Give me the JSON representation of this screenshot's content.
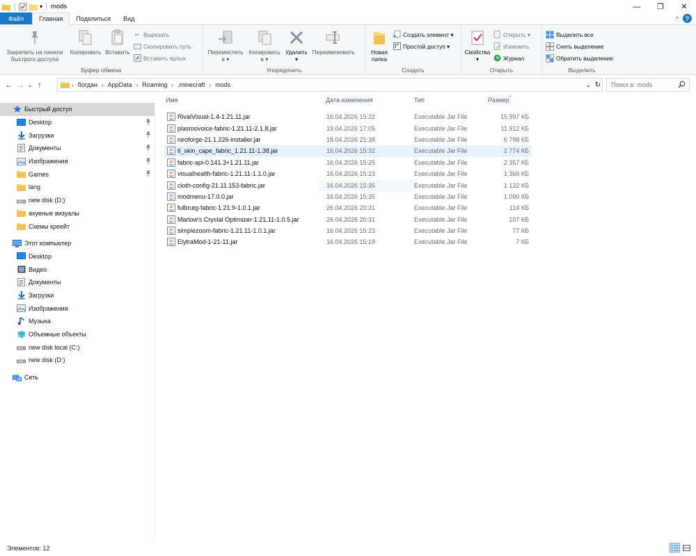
{
  "window": {
    "title": "mods",
    "controls": [
      "—",
      "❐",
      "✕"
    ]
  },
  "ribbon_tabs": [
    {
      "label": "Файл",
      "kind": "file"
    },
    {
      "label": "Главная",
      "kind": "active"
    },
    {
      "label": "Поделиться",
      "kind": "normal"
    },
    {
      "label": "Вид",
      "kind": "normal"
    }
  ],
  "ribbon": {
    "clipboard": {
      "label": "Буфер обмена",
      "pin": "Закрепить на панели быстрого доступа",
      "pin_l1": "Закрепить на панели",
      "pin_l2": "быстрого доступа",
      "copy": "Копировать",
      "paste": "Вставить",
      "cut": "Вырезать",
      "copy_path": "Скопировать путь",
      "paste_shortcut": "Вставить ярлык"
    },
    "organize": {
      "label": "Упорядочить",
      "move_l1": "Переместить",
      "move_l2": "в ▾",
      "copy_l1": "Копировать",
      "copy_l2": "в ▾",
      "delete_l1": "Удалить",
      "delete_l2": "▾",
      "rename": "Переименовать"
    },
    "create": {
      "label": "Создать",
      "new_folder_l1": "Новая",
      "new_folder_l2": "папка",
      "new_item": "Создать элемент ▾",
      "easy_access": "Простой доступ ▾"
    },
    "open": {
      "label": "Открыть",
      "properties_l1": "Свойства",
      "properties_l2": "▾",
      "open": "Открыть ▾",
      "edit": "Изменить",
      "history": "Журнал"
    },
    "select": {
      "label": "Выделить",
      "select_all": "Выделить все",
      "select_none": "Снять выделение",
      "invert": "Обратить выделение"
    }
  },
  "address": {
    "crumbs": [
      "богдан",
      "AppData",
      "Roaming",
      ".minecraft",
      "mods"
    ],
    "search_placeholder": "Поиск в: mods"
  },
  "nav": {
    "quick_access": "Быстрый доступ",
    "quick_items": [
      {
        "label": "Desktop",
        "icon": "desktop-icon",
        "pinned": true
      },
      {
        "label": "Загрузки",
        "icon": "downloads-icon",
        "pinned": true
      },
      {
        "label": "Документы",
        "icon": "documents-icon",
        "pinned": true
      },
      {
        "label": "Изображения",
        "icon": "pictures-icon",
        "pinned": true
      },
      {
        "label": "Games",
        "icon": "folder-icon",
        "pinned": true
      },
      {
        "label": "lang",
        "icon": "folder-icon",
        "pinned": false
      },
      {
        "label": "new disk (D:)",
        "icon": "drive-icon",
        "pinned": false
      },
      {
        "label": "ахуеные визуалы",
        "icon": "folder-icon",
        "pinned": false
      },
      {
        "label": "Схемы креейт",
        "icon": "folder-icon",
        "pinned": false
      }
    ],
    "this_pc": "Этот компьютер",
    "pc_items": [
      {
        "label": "Desktop",
        "icon": "desktop-icon"
      },
      {
        "label": "Видео",
        "icon": "video-icon"
      },
      {
        "label": "Документы",
        "icon": "documents-icon"
      },
      {
        "label": "Загрузки",
        "icon": "downloads-icon"
      },
      {
        "label": "Изображения",
        "icon": "pictures-icon"
      },
      {
        "label": "Музыка",
        "icon": "music-icon"
      },
      {
        "label": "Объемные объекты",
        "icon": "3d-objects-icon"
      },
      {
        "label": "new disk local (C:)",
        "icon": "drive-icon"
      },
      {
        "label": "new disk (D:)",
        "icon": "drive-icon"
      }
    ],
    "network": "Сеть"
  },
  "columns": {
    "name": "Имя",
    "date": "Дата изменения",
    "type": "Тип",
    "size": "Размер"
  },
  "files": [
    {
      "name": "RivalVisual-1.4-1.21.11.jar",
      "date": "16.04.2026 15:22",
      "type": "Executable Jar File",
      "size": "15 997 КБ"
    },
    {
      "name": "plasmovoice-fabric-1.21.11-2.1.8.jar",
      "date": "19.04.2026 17:05",
      "type": "Executable Jar File",
      "size": "11 912 КБ"
    },
    {
      "name": "neoforge-21.1.226-installer.jar",
      "date": "18.04.2026 21:38",
      "type": "Executable Jar File",
      "size": "6 798 КБ"
    },
    {
      "name": "tl_skin_cape_fabric_1.21.11-1.38.jar",
      "date": "16.04.2026 15:32",
      "type": "Executable Jar File",
      "size": "2 774 КБ"
    },
    {
      "name": "fabric-api-0.141.3+1.21.11.jar",
      "date": "16.04.2026 15:25",
      "type": "Executable Jar File",
      "size": "2 357 КБ"
    },
    {
      "name": "visualhealth-fabric-1.21.11-1.1.0.jar",
      "date": "16.04.2026 15:23",
      "type": "Executable Jar File",
      "size": "1 366 КБ"
    },
    {
      "name": "cloth-config-21.11.153-fabric.jar",
      "date": "16.04.2026 15:35",
      "type": "Executable Jar File",
      "size": "1 122 КБ"
    },
    {
      "name": "modmenu-17.0.0.jar",
      "date": "16.04.2026 15:35",
      "type": "Executable Jar File",
      "size": "1 090 КБ"
    },
    {
      "name": "fulbrutg-fabric-1.21.9-1.0.1.jar",
      "date": "26.04.2026 20:31",
      "type": "Executable Jar File",
      "size": "114 КБ"
    },
    {
      "name": "Marlow's Crystal Optimizer-1.21.11-1.0.5.jar",
      "date": "26.04.2026 20:31",
      "type": "Executable Jar File",
      "size": "107 КБ"
    },
    {
      "name": "simplezoom-fabric-1.21.11-1.0.1.jar",
      "date": "16.04.2026 15:23",
      "type": "Executable Jar File",
      "size": "77 КБ"
    },
    {
      "name": "ElytraMod-1-21-11.jar",
      "date": "16.04.2026 15:19",
      "type": "Executable Jar File",
      "size": "7 КБ"
    }
  ],
  "highlighted_row": 3,
  "status": {
    "items": "Элементов: 12"
  },
  "colors": {
    "accent": "#1979ca",
    "hover_row": "#e5f3ff",
    "quick_access_bg": "#d9d9d9",
    "folder": "#f8d775"
  }
}
